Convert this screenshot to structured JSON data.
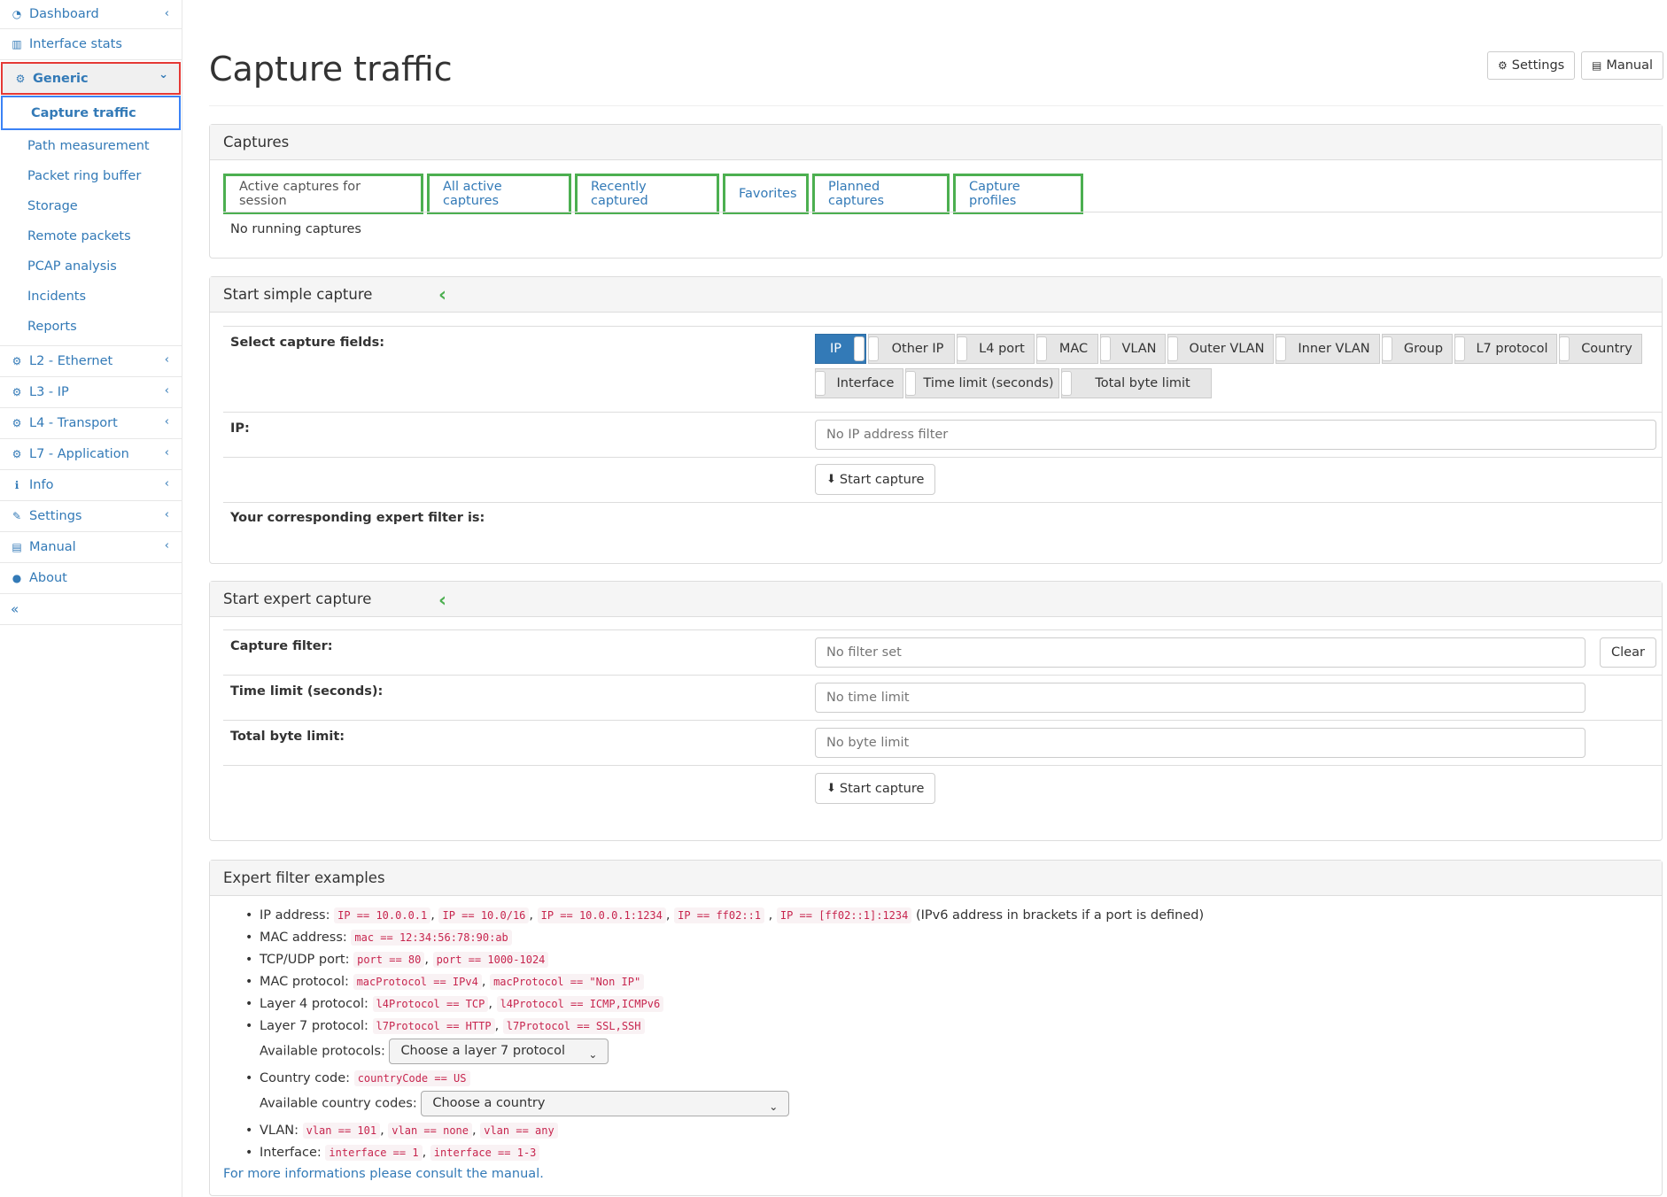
{
  "sidebar": {
    "items_top": [
      {
        "label": "Dashboard",
        "icon": "dashboard-icon",
        "chevron": "‹"
      },
      {
        "label": "Interface stats",
        "icon": "bar-chart-icon"
      }
    ],
    "generic": {
      "label": "Generic",
      "icon": "gear-icon",
      "chevron": "⌄"
    },
    "generic_sub": [
      "Capture traffic",
      "Path measurement",
      "Packet ring buffer",
      "Storage",
      "Remote packets",
      "PCAP analysis",
      "Incidents",
      "Reports"
    ],
    "items_bottom": [
      {
        "label": "L2 - Ethernet",
        "icon": "gear-icon"
      },
      {
        "label": "L3 - IP",
        "icon": "gear-icon"
      },
      {
        "label": "L4 - Transport",
        "icon": "gear-icon"
      },
      {
        "label": "L7 - Application",
        "icon": "gear-icon"
      },
      {
        "label": "Info",
        "icon": "info-icon"
      },
      {
        "label": "Settings",
        "icon": "wrench-icon"
      },
      {
        "label": "Manual",
        "icon": "book-icon"
      },
      {
        "label": "About",
        "icon": "info-circle-icon"
      }
    ],
    "collapse_glyph": "«"
  },
  "header": {
    "title": "Capture traffic",
    "settings_label": "Settings",
    "manual_label": "Manual"
  },
  "captures": {
    "heading": "Captures",
    "tabs": [
      "Active captures for session",
      "All active captures",
      "Recently captured",
      "Favorites",
      "Planned captures",
      "Capture profiles"
    ],
    "empty_text": "No running captures"
  },
  "simple": {
    "heading": "Start simple capture",
    "fields_label": "Select capture fields:",
    "fields": [
      "IP",
      "Other IP",
      "L4 port",
      "MAC",
      "VLAN",
      "Outer VLAN",
      "Inner VLAN",
      "Group",
      "L7 protocol",
      "Country",
      "Interface",
      "Time limit (seconds)",
      "Total byte limit"
    ],
    "ip_label": "IP:",
    "ip_placeholder": "No IP address filter",
    "start_label": "Start capture",
    "expert_filter_label": "Your corresponding expert filter is:"
  },
  "expert": {
    "heading": "Start expert capture",
    "filter_label": "Capture filter:",
    "filter_placeholder": "No filter set",
    "clear_label": "Clear",
    "time_label": "Time limit (seconds):",
    "time_placeholder": "No time limit",
    "byte_label": "Total byte limit:",
    "byte_placeholder": "No byte limit",
    "start_label": "Start capture"
  },
  "examples": {
    "heading": "Expert filter examples",
    "ip_prefix": "IP address:",
    "ip_codes": [
      "IP == 10.0.0.1",
      "IP == 10.0/16",
      "IP == 10.0.0.1:1234",
      "IP == ff02::1",
      "IP == [ff02::1]:1234"
    ],
    "ip_note": "(IPv6 address in brackets if a port is defined)",
    "mac_prefix": "MAC address:",
    "mac_code": "mac == 12:34:56:78:90:ab",
    "port_prefix": "TCP/UDP port:",
    "port_codes": [
      "port == 80",
      "port == 1000-1024"
    ],
    "macproto_prefix": "MAC protocol:",
    "macproto_codes": [
      "macProtocol == IPv4",
      "macProtocol == \"Non IP\""
    ],
    "l4_prefix": "Layer 4 protocol:",
    "l4_codes": [
      "l4Protocol == TCP",
      "l4Protocol == ICMP,ICMPv6"
    ],
    "l7_prefix": "Layer 7 protocol:",
    "l7_codes": [
      "l7Protocol == HTTP",
      "l7Protocol == SSL,SSH"
    ],
    "l7_available_label": "Available protocols:",
    "l7_select": "Choose a layer 7 protocol",
    "country_prefix": "Country code:",
    "country_code": "countryCode == US",
    "country_available_label": "Available country codes:",
    "country_select": "Choose a country",
    "vlan_prefix": "VLAN:",
    "vlan_codes": [
      "vlan == 101",
      "vlan == none",
      "vlan == any"
    ],
    "iface_prefix": "Interface:",
    "iface_codes": [
      "interface == 1",
      "interface == 1-3"
    ],
    "manual_link": "For more informations please consult the manual."
  },
  "colors": {
    "link": "#337ab7",
    "active_toggle": "#337ab7",
    "tab_outline": "#4caf50",
    "generic_outline": "#e53935",
    "active_sub_outline": "#3b82f6"
  }
}
